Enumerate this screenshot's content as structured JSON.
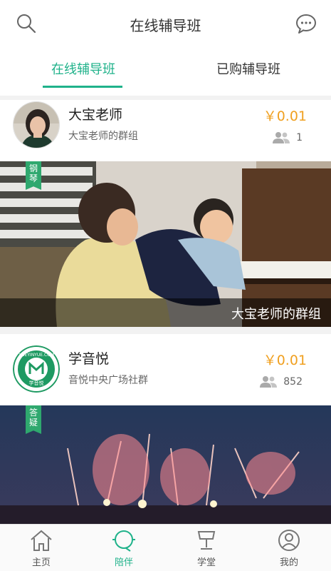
{
  "header": {
    "title": "在线辅导班",
    "search_icon": "search-icon",
    "message_icon": "chat-bubble-icon"
  },
  "tabs": [
    {
      "label": "在线辅导班",
      "active": true
    },
    {
      "label": "已购辅导班",
      "active": false
    }
  ],
  "groups": [
    {
      "name": "大宝老师",
      "subtitle": "大宝老师的群组",
      "price": "￥0.01",
      "members": "1",
      "tag": "钢琴",
      "caption": "大宝老师的群组"
    },
    {
      "name": "学音悦",
      "subtitle": "音悦中央广场社群",
      "price": "￥0.01",
      "members": "852",
      "tag": "答疑",
      "logo_top": "XUEYINYUE.COM",
      "logo_bottom": "学音悦"
    }
  ],
  "bottom_nav": [
    {
      "label": "主页",
      "icon": "home-icon",
      "active": false
    },
    {
      "label": "陪伴",
      "icon": "companion-icon",
      "active": true
    },
    {
      "label": "学堂",
      "icon": "lectern-icon",
      "active": false
    },
    {
      "label": "我的",
      "icon": "profile-icon",
      "active": false
    }
  ],
  "colors": {
    "accent": "#1fb28a",
    "price": "#f0a020",
    "tag": "#2fa86e"
  }
}
